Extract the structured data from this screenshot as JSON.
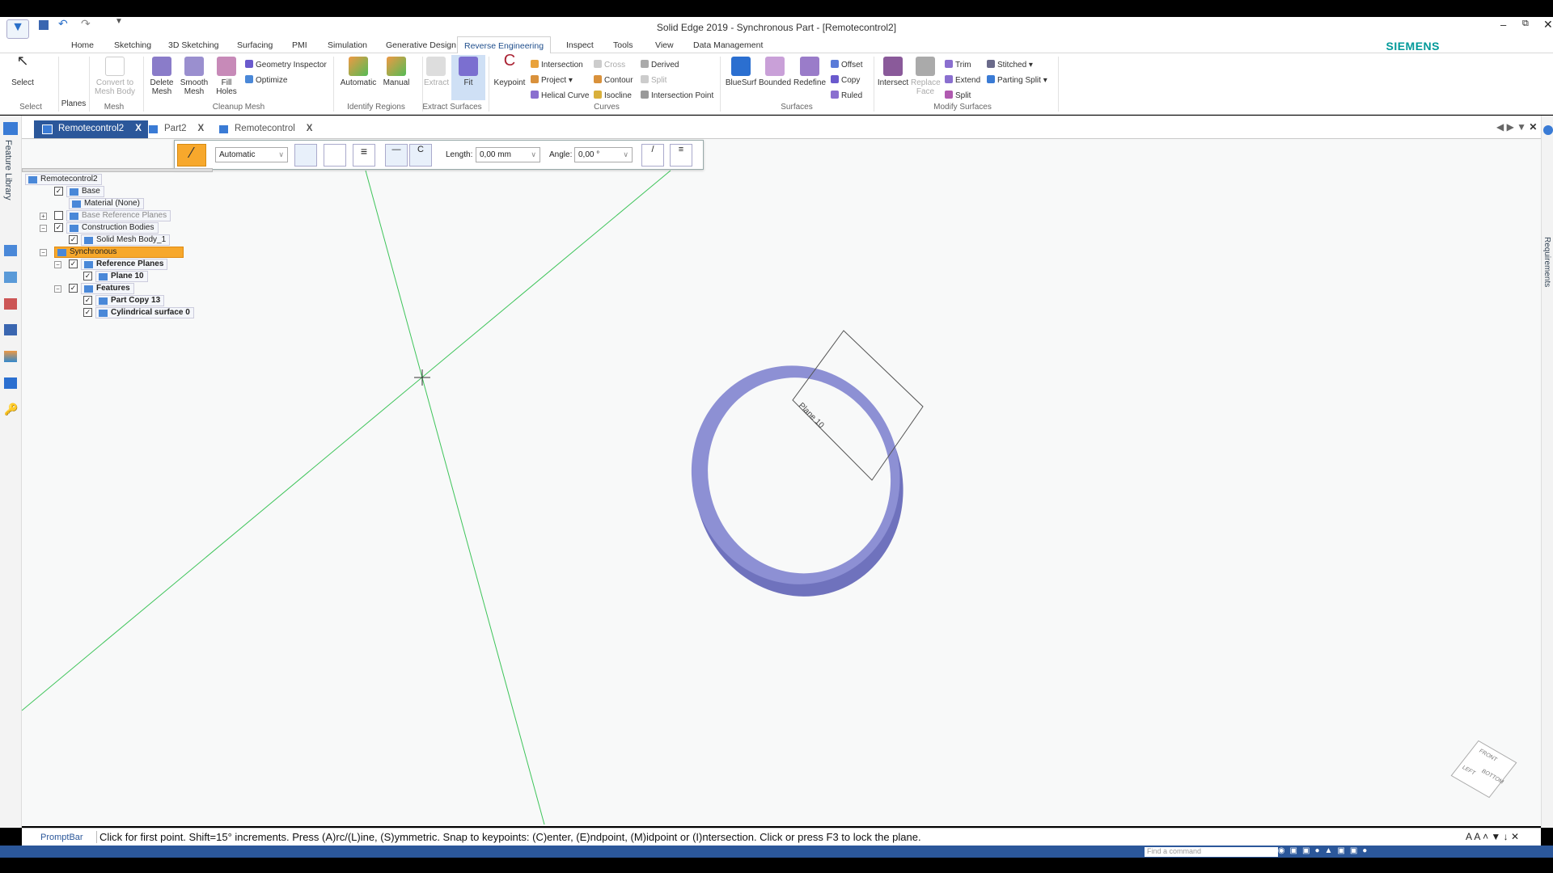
{
  "window": {
    "title": "Solid Edge 2019 - Synchronous Part - [Remotecontrol2]",
    "brand": "SIEMENS"
  },
  "menu_tabs": [
    "Home",
    "Sketching",
    "3D Sketching",
    "Surfacing",
    "PMI",
    "Simulation",
    "Generative Design",
    "Reverse Engineering",
    "Inspect",
    "Tools",
    "View",
    "Data Management"
  ],
  "active_menu_tab": "Reverse Engineering",
  "ribbon": {
    "select": {
      "label": "Select",
      "group": "Select"
    },
    "planes": {
      "label": "Planes"
    },
    "mesh": {
      "label": "Convert to Mesh Body",
      "group": "Mesh"
    },
    "cleanup": {
      "delete": "Delete Mesh",
      "smooth": "Smooth Mesh",
      "fill": "Fill Holes",
      "geom": "Geometry Inspector",
      "optimize": "Optimize",
      "group": "Cleanup Mesh"
    },
    "identify": {
      "automatic": "Automatic",
      "manual": "Manual",
      "group": "Identify Regions"
    },
    "extract": {
      "extract": "Extract",
      "fit": "Fit",
      "group": "Extract Surfaces"
    },
    "curves": {
      "keypoint": "Keypoint",
      "intersection": "Intersection",
      "project": "Project",
      "helical": "Helical Curve",
      "cross": "Cross",
      "contour": "Contour",
      "isocline": "Isocline",
      "derived": "Derived",
      "split": "Split",
      "intpoint": "Intersection Point",
      "group": "Curves"
    },
    "surfaces": {
      "bluesurf": "BlueSurf",
      "bounded": "Bounded",
      "redefine": "Redefine",
      "offset": "Offset",
      "copy": "Copy",
      "ruled": "Ruled",
      "group": "Surfaces"
    },
    "modify": {
      "intersect": "Intersect",
      "replace": "Replace Face",
      "trim": "Trim",
      "extend": "Extend",
      "split": "Split",
      "stitched": "Stitched",
      "parting": "Parting Split",
      "group": "Modify Surfaces"
    }
  },
  "doc_tabs": [
    {
      "label": "Remotecontrol2",
      "active": true
    },
    {
      "label": "Part2"
    },
    {
      "label": "Remotecontrol"
    }
  ],
  "close_glyph": "X",
  "left_strip_label": "Feature Library",
  "right_strip_label": "Requirements",
  "command_bar": {
    "mode": "Automatic",
    "length_label": "Length:",
    "length_value": "0,00 mm",
    "angle_label": "Angle:",
    "angle_value": "0,00 °"
  },
  "tree": [
    {
      "label": "Remotecontrol2",
      "level": 0
    },
    {
      "label": "Base",
      "level": 1,
      "checked": true
    },
    {
      "label": "Material (None)",
      "level": 2
    },
    {
      "label": "Base Reference Planes",
      "level": 1,
      "checked": false,
      "expander": "+"
    },
    {
      "label": "Construction Bodies",
      "level": 1,
      "checked": true,
      "expander": "-"
    },
    {
      "label": "Solid Mesh Body_1",
      "level": 2,
      "checked": true
    },
    {
      "label": "Synchronous",
      "level": 1,
      "highlight": true,
      "expander": "-"
    },
    {
      "label": "Reference Planes",
      "level": 2,
      "checked": true,
      "expander": "-",
      "bold": true
    },
    {
      "label": "Plane 10",
      "level": 3,
      "checked": true,
      "bold": true
    },
    {
      "label": "Features",
      "level": 2,
      "checked": true,
      "expander": "-",
      "bold": true
    },
    {
      "label": "Part Copy 13",
      "level": 3,
      "checked": true,
      "bold": true
    },
    {
      "label": "Cylindrical surface 0",
      "level": 3,
      "checked": true,
      "bold": true
    }
  ],
  "viewport": {
    "plane_label": "Plane 10",
    "view_cube": [
      "FRONT",
      "LEFT",
      "BOTTOM"
    ],
    "ring_color": "#7b7ec6",
    "sketch_line_color": "#3ec45a"
  },
  "prompt": {
    "label": "PromptBar",
    "text": "Click for first point.  Shift=15° increments. Press (A)rc/(L)ine, (S)ymmetric. Snap to keypoints: (C)enter, (E)ndpoint, (M)idpoint or (I)ntersection.  Click or press F3 to lock the plane."
  },
  "statusbar": {
    "find_placeholder": "Find a command"
  },
  "colors": {
    "accent": "#2b579a",
    "highlight": "#f7a82c"
  }
}
